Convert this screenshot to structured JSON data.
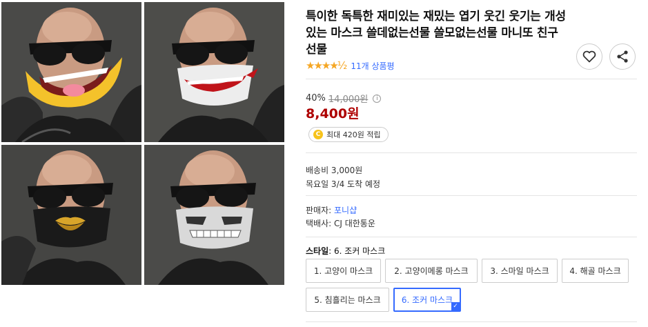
{
  "product": {
    "title": "특이한 독특한 재미있는 재밌는 엽기 웃긴 웃기는 개성있는 마스크 쓸데없는선물 쓸모없는선물 마니또 친구 선물",
    "rating_stars": "★★★★½",
    "rating": 4.5,
    "review_count": "11개 상품평"
  },
  "pricing": {
    "discount": "40%",
    "original_price": "14,000원",
    "sale_price": "8,400원",
    "reward_text": "최대 420원 적립",
    "reward_coin": "C"
  },
  "shipping": {
    "fee": "배송비 3,000원",
    "eta": "목요일 3/4 도착 예정"
  },
  "seller": {
    "seller_label": "판매자: ",
    "seller_name": "포니샵",
    "courier": "택배사: CJ 대한통운"
  },
  "options": {
    "label": "스타일",
    "selected_value": ": 6. 조커 마스크",
    "items": [
      {
        "label": "1. 고양이 마스크"
      },
      {
        "label": "2. 고양이메롱 마스크"
      },
      {
        "label": "3. 스마일 마스크"
      },
      {
        "label": "4. 해골 마스크"
      },
      {
        "label": "5. 침흘리는 마스크"
      },
      {
        "label": "6. 조커 마스크"
      }
    ]
  },
  "icons": {
    "favorite": "heart-icon",
    "share": "share-icon",
    "info": "info-icon",
    "selected": "check-icon"
  },
  "colors": {
    "price_red": "#ae0000",
    "link_blue": "#346aff",
    "star": "#f5a623",
    "coin": "#f7c31b"
  }
}
